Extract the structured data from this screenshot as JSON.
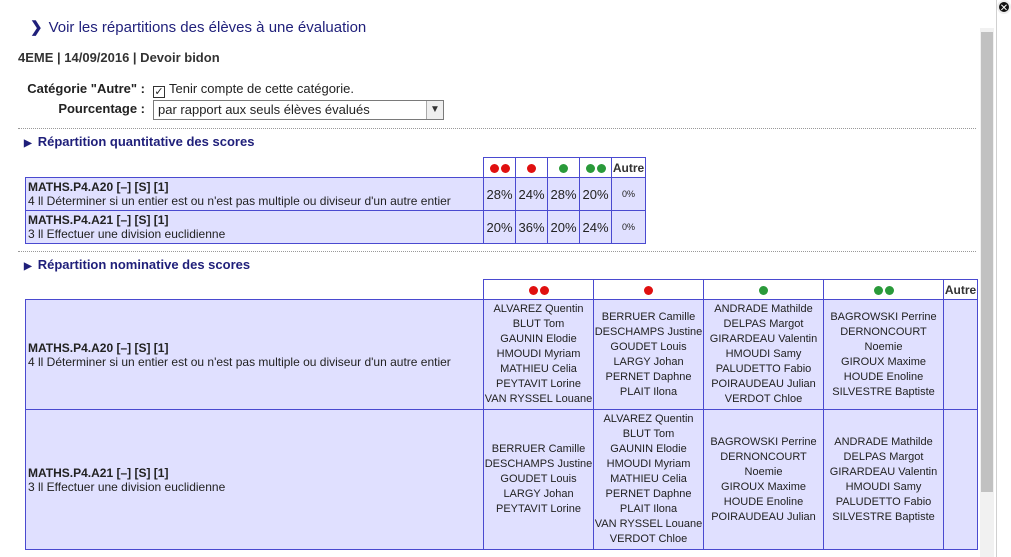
{
  "dialog": {
    "title": "Voir les répartitions des élèves à une évaluation",
    "subtitle": "4EME | 14/09/2016 | Devoir bidon"
  },
  "form": {
    "category_label": "Catégorie \"Autre\" :",
    "category_checkbox_label": "Tenir compte de cette catégorie.",
    "category_checked": true,
    "percentage_label": "Pourcentage :",
    "percentage_value": "par rapport aux seuls élèves évalués"
  },
  "quantitative": {
    "heading": "Répartition quantitative des scores",
    "autre_label": "Autre",
    "columns": [
      {
        "icon": "double-red-dot-icon",
        "color": "#e01010",
        "count": 2
      },
      {
        "icon": "red-dot-icon",
        "color": "#e01010",
        "count": 1
      },
      {
        "icon": "green-dot-icon",
        "color": "#2a9a3a",
        "count": 1
      },
      {
        "icon": "double-green-dot-icon",
        "color": "#2a9a3a",
        "count": 2
      }
    ],
    "rows": [
      {
        "code": "MATHS.P4.A20 [–] [S] [1]",
        "desc": "4 ll Déterminer si un entier est ou n'est pas multiple ou diviseur d'un autre entier",
        "values": [
          "28%",
          "24%",
          "28%",
          "20%"
        ],
        "autre": "0%"
      },
      {
        "code": "MATHS.P4.A21 [–] [S] [1]",
        "desc": "3 ll Effectuer une division euclidienne",
        "values": [
          "20%",
          "36%",
          "20%",
          "24%"
        ],
        "autre": "0%"
      }
    ]
  },
  "nominative": {
    "heading": "Répartition nominative des scores",
    "autre_label": "Autre",
    "rows": [
      {
        "code": "MATHS.P4.A20 [–] [S] [1]",
        "desc": "4 ll Déterminer si un entier est ou n'est pas multiple ou diviseur d'un autre entier",
        "groups": [
          [
            "ALVAREZ Quentin",
            "BLUT Tom",
            "GAUNIN Elodie",
            "HMOUDI Myriam",
            "MATHIEU Celia",
            "PEYTAVIT Lorine",
            "VAN RYSSEL Louane"
          ],
          [
            "BERRUER Camille",
            "DESCHAMPS Justine",
            "GOUDET Louis",
            "LARGY Johan",
            "PERNET Daphne",
            "PLAIT Ilona"
          ],
          [
            "ANDRADE Mathilde",
            "DELPAS Margot",
            "GIRARDEAU Valentin",
            "HMOUDI Samy",
            "PALUDETTO Fabio",
            "POIRAUDEAU Julian",
            "VERDOT Chloe"
          ],
          [
            "BAGROWSKI Perrine",
            "DERNONCOURT Noemie",
            "GIROUX Maxime",
            "HOUDE Enoline",
            "SILVESTRE Baptiste"
          ]
        ]
      },
      {
        "code": "MATHS.P4.A21 [–] [S] [1]",
        "desc": "3 ll Effectuer une division euclidienne",
        "groups": [
          [
            "BERRUER Camille",
            "DESCHAMPS Justine",
            "GOUDET Louis",
            "LARGY Johan",
            "PEYTAVIT Lorine"
          ],
          [
            "ALVAREZ Quentin",
            "BLUT Tom",
            "GAUNIN Elodie",
            "HMOUDI Myriam",
            "MATHIEU Celia",
            "PERNET Daphne",
            "PLAIT Ilona",
            "VAN RYSSEL Louane",
            "VERDOT Chloe"
          ],
          [
            "BAGROWSKI Perrine",
            "DERNONCOURT Noemie",
            "GIROUX Maxime",
            "HOUDE Enoline",
            "POIRAUDEAU Julian"
          ],
          [
            "ANDRADE Mathilde",
            "DELPAS Margot",
            "GIRARDEAU Valentin",
            "HMOUDI Samy",
            "PALUDETTO Fabio",
            "SILVESTRE Baptiste"
          ]
        ]
      }
    ]
  }
}
